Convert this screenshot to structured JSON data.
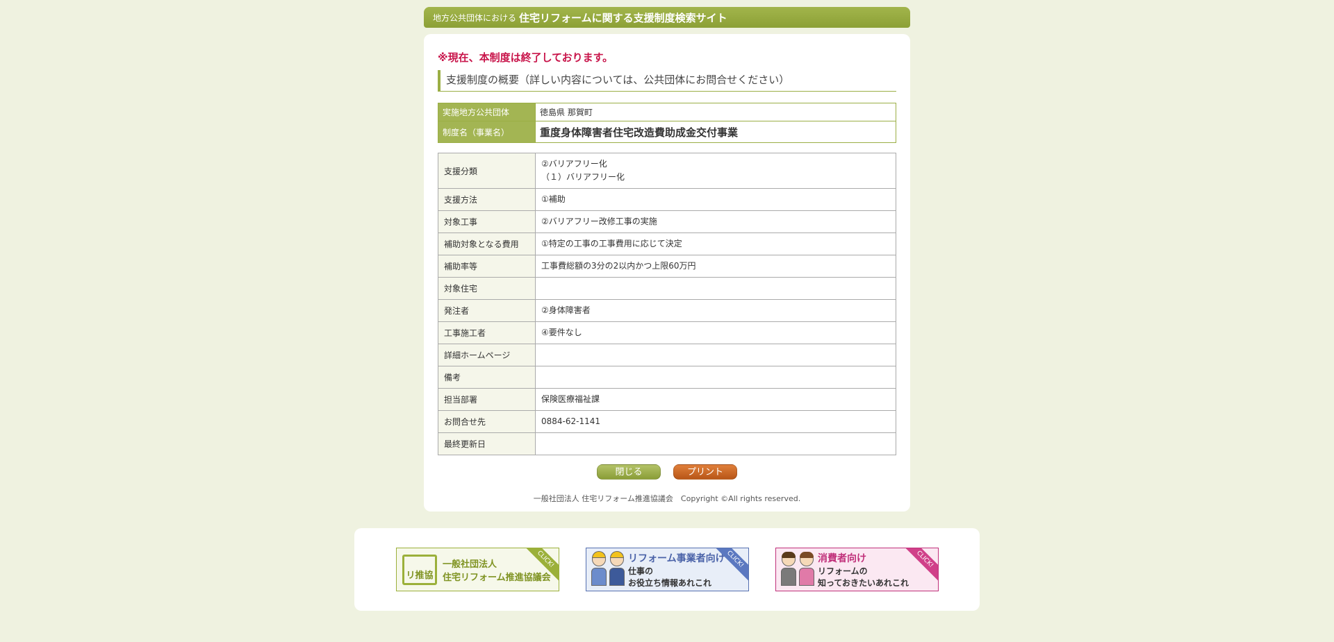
{
  "header": {
    "subtitle": "地方公共団体における",
    "title": "住宅リフォームに関する支援制度検索サイト"
  },
  "notice": "※現在、本制度は終了しております。",
  "section_heading": "支援制度の概要（詳しい内容については、公共団体にお問合せください）",
  "info": {
    "rows": [
      {
        "label": "実施地方公共団体",
        "value": "徳島県 那賀町"
      },
      {
        "label": "制度名（事業名）",
        "value": "重度身体障害者住宅改造費助成金交付事業"
      }
    ]
  },
  "details": {
    "support_category": {
      "label": "支援分類",
      "line1": "②バリアフリー化",
      "line2": "（１）バリアフリー化"
    },
    "rows": [
      {
        "label": "支援方法",
        "value": "①補助"
      },
      {
        "label": "対象工事",
        "value": "②バリアフリー改修工事の実施"
      },
      {
        "label": "補助対象となる費用",
        "value": "①特定の工事の工事費用に応じて決定"
      },
      {
        "label": "補助率等",
        "value": "工事費総額の3分の2以内かつ上限60万円"
      },
      {
        "label": "対象住宅",
        "value": ""
      },
      {
        "label": "発注者",
        "value": "②身体障害者"
      },
      {
        "label": "工事施工者",
        "value": "④要件なし"
      },
      {
        "label": "詳細ホームページ",
        "value": ""
      },
      {
        "label": "備考",
        "value": ""
      },
      {
        "label": "担当部署",
        "value": "保険医療福祉課"
      },
      {
        "label": "お問合せ先",
        "value": "0884-62-1141"
      },
      {
        "label": "最終更新日",
        "value": ""
      }
    ]
  },
  "buttons": {
    "close": "閉じる",
    "print": "プリント"
  },
  "copyright": "一般社団法人 住宅リフォーム推進協議会　Copyright ©All rights reserved.",
  "banners": {
    "association": {
      "logo": "リ推協",
      "line1": "一般社団法人",
      "line2": "住宅リフォーム推進協議会",
      "ribbon": "CLICK!"
    },
    "business": {
      "line1": "リフォーム事業者向け",
      "line2": "仕事の",
      "line3": "お役立ち情報あれこれ",
      "ribbon": "CLICK!"
    },
    "consumer": {
      "line1": "消費者向け",
      "line2": "リフォームの",
      "line3": "知っておきたいあれこれ",
      "ribbon": "CLICK!"
    }
  },
  "colors": {
    "accent": "#9bae45",
    "notice": "#c8144a",
    "print": "#c7621f",
    "background": "#eff2e0"
  }
}
